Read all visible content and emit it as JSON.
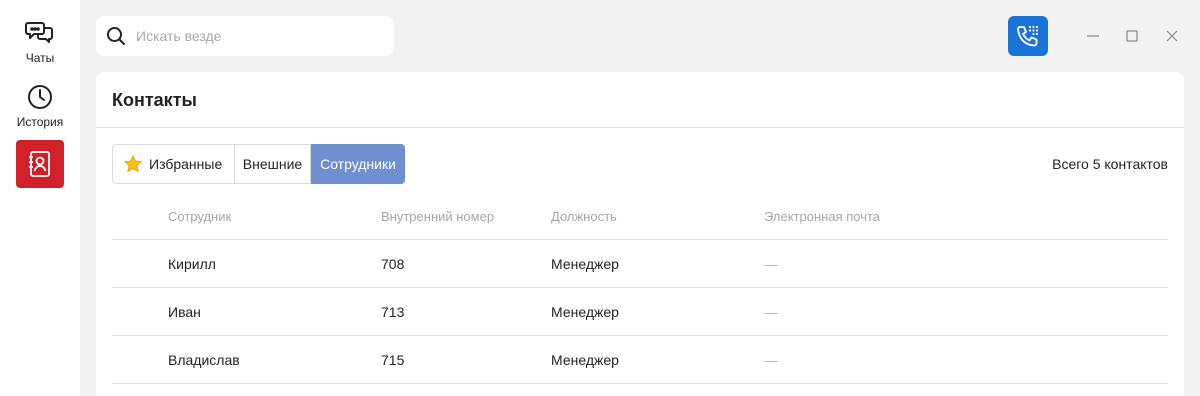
{
  "sidebar": {
    "items": [
      {
        "label": "Чаты",
        "icon": "chat-bubbles-icon"
      },
      {
        "label": "История",
        "icon": "clock-icon"
      },
      {
        "label": "",
        "icon": "contacts-book-icon",
        "active": true
      }
    ],
    "active_color": "#d0202a"
  },
  "search": {
    "placeholder": "Искать везде",
    "value": ""
  },
  "toolbar": {
    "call_icon": "phone-dialpad-icon",
    "accent": "#1a73d9"
  },
  "window": {
    "controls": [
      "minimize-icon",
      "maximize-icon",
      "close-icon"
    ]
  },
  "contacts": {
    "title": "Контакты",
    "tabs": [
      {
        "label": "Избранные",
        "icon": "star-icon"
      },
      {
        "label": "Внешние"
      },
      {
        "label": "Сотрудники",
        "active": true
      }
    ],
    "active_tab_color": "#6f8fce",
    "total": "Всего 5 контактов",
    "columns": [
      "Сотрудник",
      "Внутренний номер",
      "Должность",
      "Электронная почта"
    ],
    "rows": [
      {
        "name": "Кирилл",
        "number": "708",
        "position": "Менеджер",
        "email": "—"
      },
      {
        "name": "Иван",
        "number": "713",
        "position": "Менеджер",
        "email": "—"
      },
      {
        "name": "Владислав",
        "number": "715",
        "position": "Менеджер",
        "email": "—"
      }
    ]
  }
}
